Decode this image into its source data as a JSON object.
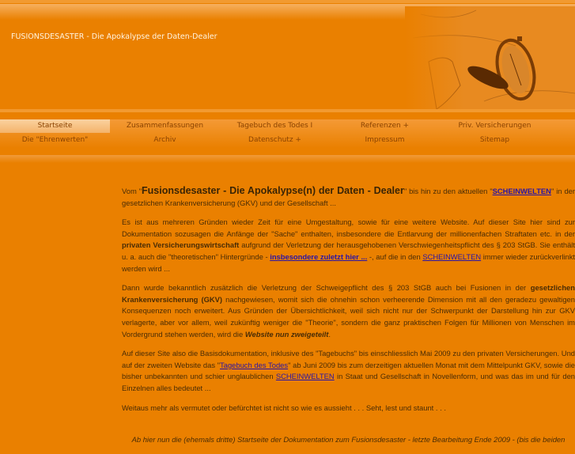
{
  "header": {
    "site_title": "FUSIONSDESASTER - Die Apokalypse der Daten-Dealer"
  },
  "nav": {
    "row1": [
      "Startseite",
      "Zusammenfassungen",
      "Tagebuch des Todes I",
      "Referenzen +",
      "Priv. Versicherungen"
    ],
    "row2": [
      "Die \"Ehrenwerten\"",
      "Archiv",
      "Datenschutz +",
      "Impressum",
      "Sitemap"
    ],
    "active": "Startseite"
  },
  "content": {
    "p1": {
      "a": "Vom \"",
      "title": "Fusionsdesaster - Die Apokalypse(n) der Daten - Dealer",
      "b": "\" bis hin zu den aktuellen \"",
      "link": "SCHEINWELTEN",
      "c": "\" in der gesetzlichen Krankenversicherung (GKV) und der Gesellschaft ..."
    },
    "p2": {
      "a": "Es ist aus mehreren Gründen wieder Zeit für eine Umgestaltung, sowie für eine weitere Website. Auf dieser Site hier sind zur Dokumentation sozusagen die Anfänge der \"Sache\" enthalten, insbesondere die Entlarvung der millionenfachen Straftaten etc. in der ",
      "bold": "privaten Versicherungswirtschaft",
      "b": " aufgrund der Verletzung der herausgehobenen Verschwiegenheitspflicht des § 203 StGB. Sie enthält u. a. auch die \"theoretischen\" Hintergründe - ",
      "link1": "insbesondere zuletzt hier ...",
      "c": " -, auf die in den ",
      "link2": "SCHEINWELTEN",
      "d": " immer wieder zurückverlinkt werden wird ..."
    },
    "p3": {
      "a": "Dann wurde bekanntlich zusätzlich die Verletzung der Schweigepflicht des § 203 StGB auch bei Fusionen in der ",
      "bold": "gesetzlichen Krankenversicherung (GKV)",
      "b": " nachgewiesen, womit sich die ohnehin schon verheerende Dimension mit all den geradezu gewaltigen Konsequenzen noch erweitert. Aus Gründen der Übersichtlichkeit, weil sich nicht nur der Schwerpunkt der Darstellung hin zur GKV verlagerte, aber vor allem, weil zukünftig weniger die \"Theorie\", sondern die ganz praktischen Folgen für Millionen von Menschen im Vordergrund stehen werden, wird die ",
      "bolditalic": "Website nun zweigeteilt",
      "c": "."
    },
    "p4": {
      "a": "Auf dieser Site also die Basisdokumentation, inklusive des \"Tagebuchs\" bis einschliesslich Mai 2009 zu den privaten Versicherungen. Und auf der zweiten Website das \"",
      "link1": "Tagebuch des Todes",
      "b": "\" ab Juni 2009 bis zum derzeitigen aktuellen Monat mit dem Mittelpunkt GKV, sowie die bisher unbekannten und schier unglaublichen ",
      "link2": "SCHEINWELTEN",
      "c": " in Staat und Gesellschaft in Novellenform, und was das im und für den Einzelnen alles bedeutet ..."
    },
    "p5": "Weitaus mehr als vermutet oder befürchtet ist nicht so wie es aussieht . . . Seht, lest und staunt . . .",
    "p6": "Ab hier nun die (ehemals dritte) Startseite der Dokumentation zum Fusionsdesaster - letzte Bearbeitung Ende 2009 - (bis die beiden"
  }
}
